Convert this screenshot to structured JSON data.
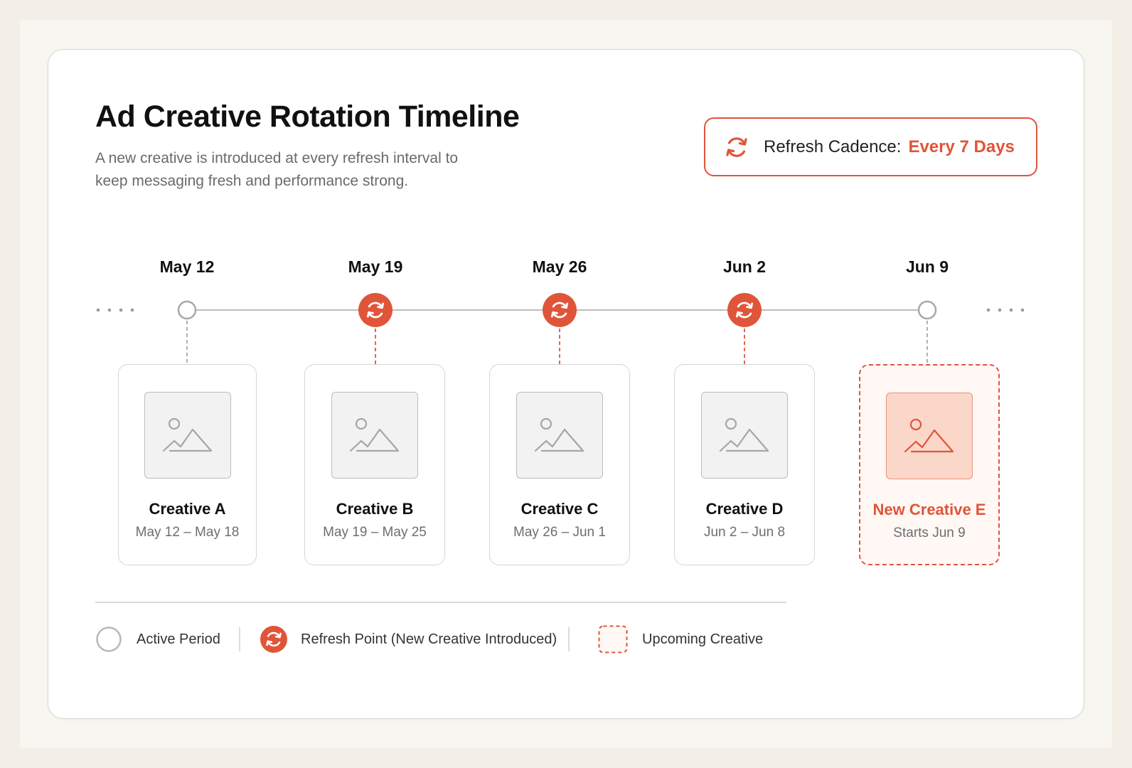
{
  "title": "Ad Creative Rotation Timeline",
  "subtitle": "A new creative is introduced at every refresh interval to keep messaging fresh and performance strong.",
  "cadence": {
    "label": "Refresh Cadence:",
    "value": "Every 7 Days",
    "icon": "refresh-icon"
  },
  "colors": {
    "accent": "#e0553a",
    "line": "#bdbdbd",
    "text": "#111111",
    "muted": "#6e6e6e"
  },
  "timeline": {
    "nodes": [
      {
        "date": "May 12",
        "kind": "active"
      },
      {
        "date": "May 19",
        "kind": "refresh"
      },
      {
        "date": "May 26",
        "kind": "refresh"
      },
      {
        "date": "Jun 2",
        "kind": "refresh"
      },
      {
        "date": "Jun 9",
        "kind": "active"
      }
    ]
  },
  "creatives": [
    {
      "name": "Creative A",
      "range": "May 12 – May 18",
      "upcoming": false,
      "icon": "image-placeholder-icon"
    },
    {
      "name": "Creative B",
      "range": "May 19 – May 25",
      "upcoming": false,
      "icon": "image-placeholder-icon"
    },
    {
      "name": "Creative C",
      "range": "May 26 – Jun 1",
      "upcoming": false,
      "icon": "image-placeholder-icon"
    },
    {
      "name": "Creative D",
      "range": "Jun 2 – Jun 8",
      "upcoming": false,
      "icon": "image-placeholder-icon"
    },
    {
      "name": "New Creative E",
      "range": "Starts Jun 9",
      "upcoming": true,
      "icon": "image-placeholder-icon"
    }
  ],
  "legend": {
    "active": "Active Period",
    "refresh": "Refresh Point (New Creative Introduced)",
    "upcoming": "Upcoming Creative"
  }
}
